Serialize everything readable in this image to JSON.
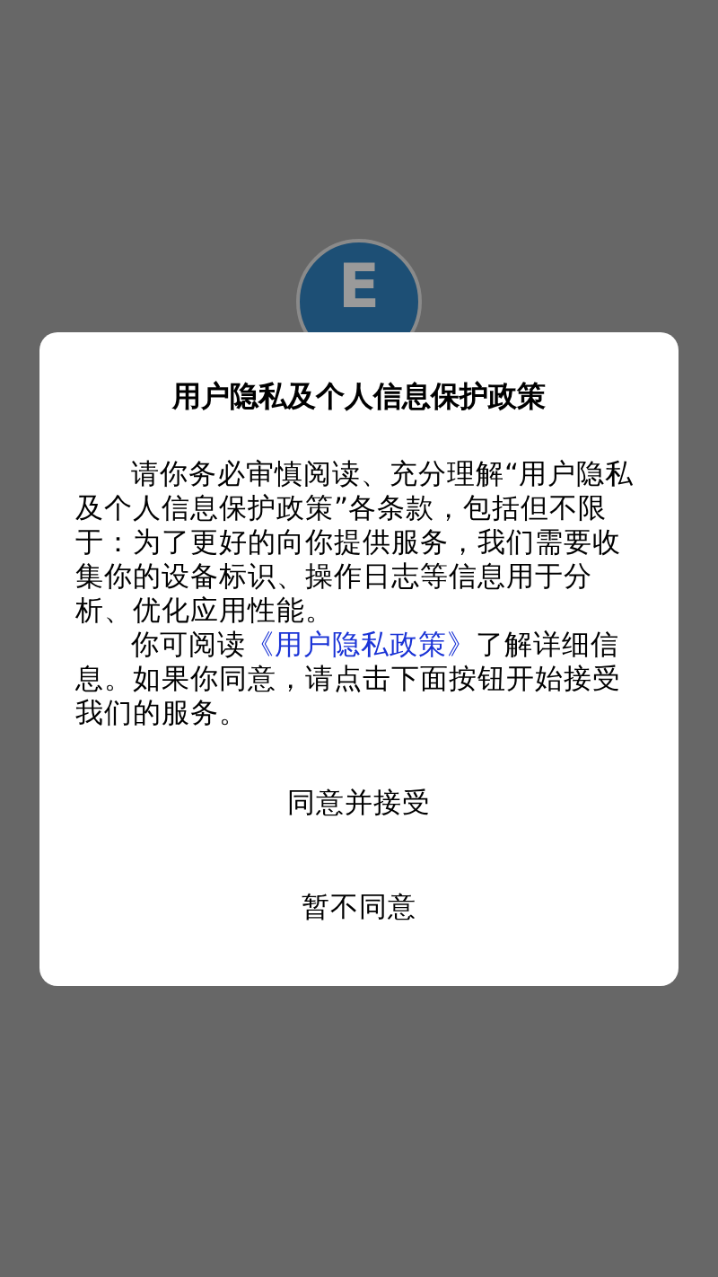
{
  "logo": {
    "letter": "E"
  },
  "dialog": {
    "title": "用户隐私及个人信息保护政策",
    "paragraphs": [
      {
        "parts": [
          {
            "text": "请你务必审慎阅读、充分理解“用户隐私及个人信息保护政策”各条款，包括但不限于：为了更好的向你提供服务，我们需要收集你的设备标识、操作日志等信息用于分析、优化应用性能。",
            "kind": "text"
          }
        ]
      },
      {
        "parts": [
          {
            "text": "你可阅读",
            "kind": "text"
          },
          {
            "text": "《用户隐私政策》",
            "kind": "link"
          },
          {
            "text": "了解详细信息。如果你同意，请点击下面按钮开始接受我们的服务。",
            "kind": "text"
          }
        ]
      }
    ],
    "buttons": [
      "同意并接受",
      "暂不同意"
    ]
  }
}
